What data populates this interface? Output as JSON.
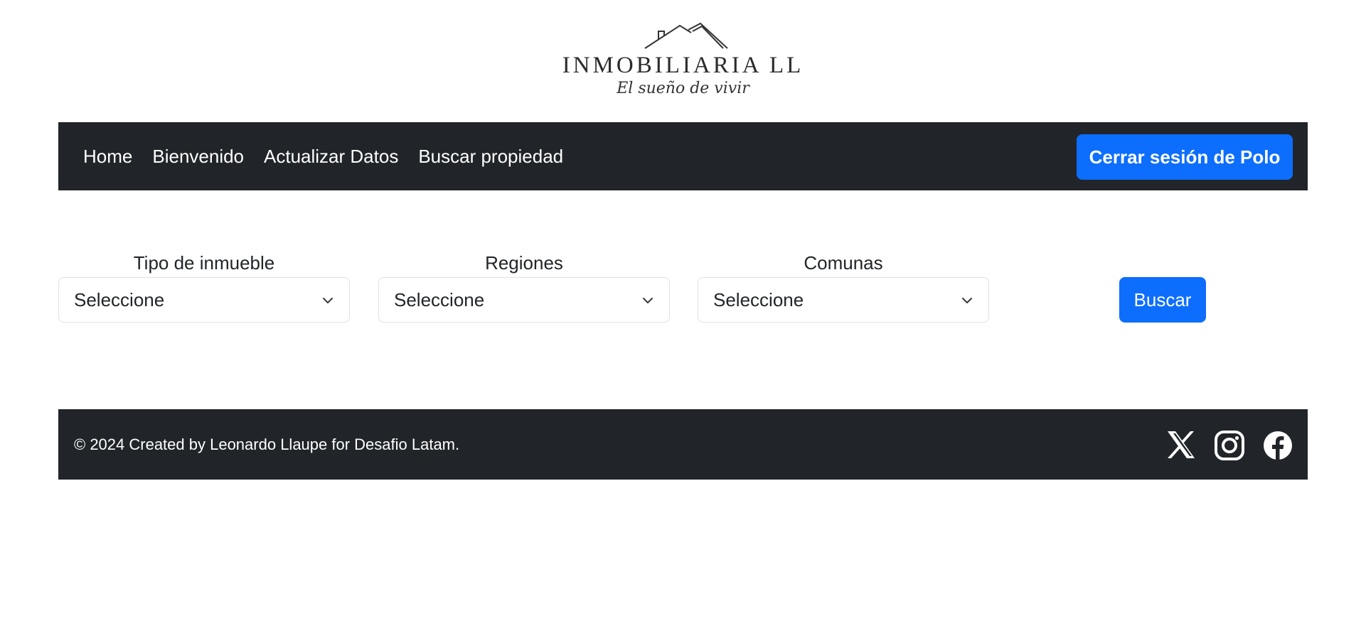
{
  "logo": {
    "name": "INMOBILIARIA LL",
    "tagline": "El sueño de vivir"
  },
  "navbar": {
    "links": [
      "Home",
      "Bienvenido",
      "Actualizar Datos",
      "Buscar propiedad"
    ],
    "logout_label": "Cerrar sesión de Polo",
    "background": "#212529"
  },
  "search": {
    "fields": [
      {
        "label": "Tipo de inmueble",
        "value": "Seleccione"
      },
      {
        "label": "Regiones",
        "value": "Seleccione"
      },
      {
        "label": "Comunas",
        "value": "Seleccione"
      }
    ],
    "button_label": "Buscar",
    "accent": "#0d6efd"
  },
  "footer": {
    "text": "© 2024 Created by Leonardo Llaupe for Desafio Latam.",
    "social_icons": [
      "x-icon",
      "instagram-icon",
      "facebook-icon"
    ]
  }
}
